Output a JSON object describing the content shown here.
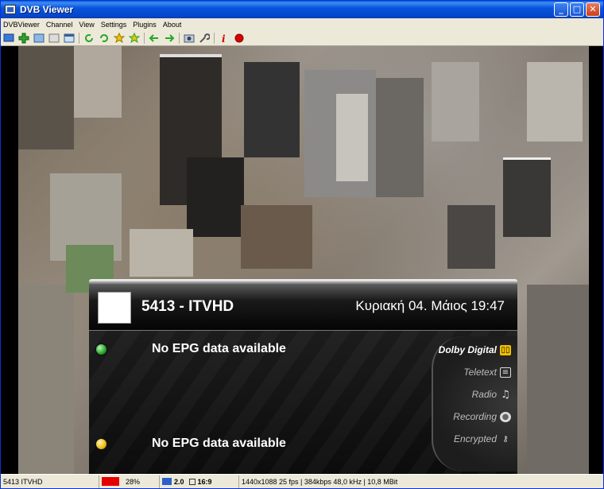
{
  "window": {
    "title": "DVB Viewer"
  },
  "title_buttons": {
    "minimize": "_",
    "maximize": "□",
    "close": "✕"
  },
  "menu": [
    "DVBViewer",
    "Channel",
    "View",
    "Settings",
    "Plugins",
    "About"
  ],
  "toolbar_icons": [
    "tv-icon",
    "add-green-icon",
    "picture-icon",
    "screen-icon",
    "window-icon",
    "refresh-icon",
    "refresh-green-icon",
    "star-icon",
    "star-add-icon",
    "arrow-left-icon",
    "arrow-right-icon",
    "snapshot-icon",
    "wrench-icon",
    "info-icon",
    "record-icon"
  ],
  "osd": {
    "channel": "5413 - ITVHD",
    "datetime": "Κυριακή 04. Μάιος 19:47",
    "epg": [
      {
        "text": "No EPG data available",
        "dot_color": "#2fae2f"
      },
      {
        "text": "No EPG data available",
        "dot_color": "#f0c21c"
      }
    ],
    "features": [
      {
        "label": "Dolby Digital",
        "icon": "dolby-icon",
        "active": true
      },
      {
        "label": "Teletext",
        "icon": "teletext-icon",
        "active": false
      },
      {
        "label": "Radio",
        "icon": "music-note-icon",
        "active": false
      },
      {
        "label": "Recording",
        "icon": "record-disc-icon",
        "active": false
      },
      {
        "label": "Encrypted",
        "icon": "key-icon",
        "active": false
      }
    ]
  },
  "status": {
    "channel": "5413 ITVHD",
    "signal_quality": "28%",
    "audio": "2.0",
    "aspect": "16:9",
    "stream_info": "1440x1088 25 fps | 384kbps 48,0 kHz | 10,8 MBit"
  },
  "colors": {
    "titlebar": "#0855dd",
    "osd_active": "#ffffff",
    "osd_inactive": "#bdbdbd",
    "status_red": "#e60000"
  }
}
